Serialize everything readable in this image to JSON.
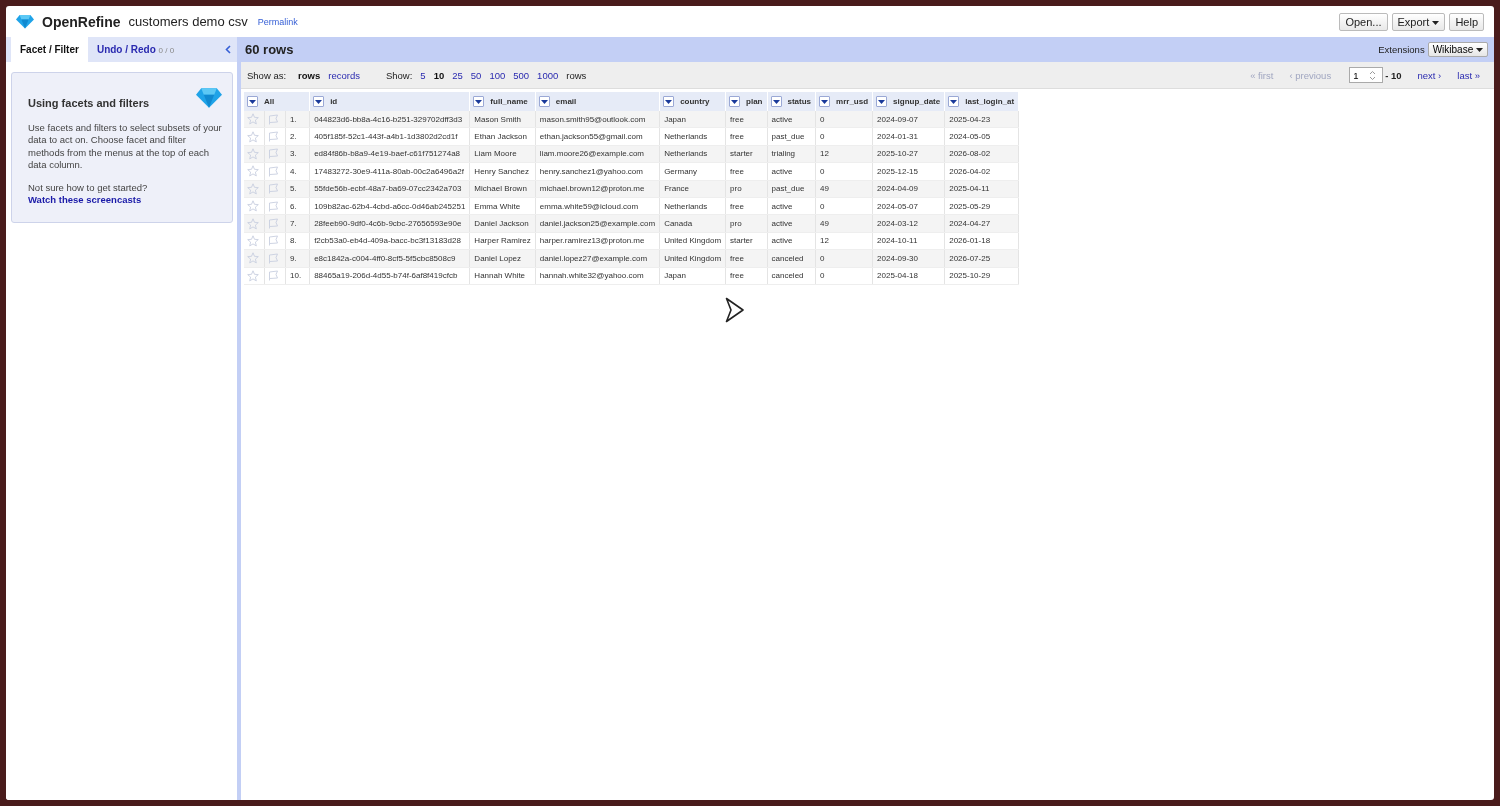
{
  "app": {
    "name": "OpenRefine",
    "project": "customers demo csv",
    "permalink": "Permalink"
  },
  "top_buttons": [
    {
      "label": "Open...",
      "dropdown": false
    },
    {
      "label": "Export",
      "dropdown": true
    },
    {
      "label": "Help",
      "dropdown": false
    }
  ],
  "left_tabs": [
    {
      "label": "Facet / Filter",
      "selected": true
    },
    {
      "label": "Undo / Redo",
      "count": "0 / 0",
      "selected": false
    }
  ],
  "help_card": {
    "title": "Using facets and filters",
    "body": "Use facets and filters to select subsets of your data to act on. Choose facet and filter methods from the menus at the top of each data column.",
    "prompt": "Not sure how to get started?",
    "link": "Watch these screencasts"
  },
  "grid_header": {
    "row_count": "60 rows",
    "extensions_label": "Extensions",
    "extensions_button": "Wikibase"
  },
  "view_bar": {
    "show_as_label": "Show as:",
    "modes": [
      {
        "label": "rows",
        "selected": true
      },
      {
        "label": "records",
        "selected": false
      }
    ],
    "show_label": "Show:",
    "page_sizes": [
      {
        "label": "5",
        "selected": false
      },
      {
        "label": "10",
        "selected": true
      },
      {
        "label": "25",
        "selected": false
      },
      {
        "label": "50",
        "selected": false
      },
      {
        "label": "100",
        "selected": false
      },
      {
        "label": "500",
        "selected": false
      },
      {
        "label": "1000",
        "selected": false
      }
    ],
    "unit": "rows"
  },
  "pager": {
    "first": {
      "label": "« first",
      "disabled": true
    },
    "previous": {
      "label": "‹ previous",
      "disabled": true
    },
    "page": "1",
    "to": "- 10",
    "next": {
      "label": "next ›",
      "disabled": false
    },
    "last": {
      "label": "last »",
      "disabled": false
    }
  },
  "table": {
    "all_label": "All",
    "columns": [
      "id",
      "full_name",
      "email",
      "country",
      "plan",
      "status",
      "mrr_usd",
      "signup_date",
      "last_login_at"
    ],
    "rows": [
      {
        "number": "1.",
        "starred": false,
        "flagged": false,
        "cells": [
          "044823d6-bb8a-4c16-b251-329702dff3d3",
          "Mason Smith",
          "mason.smith95@outlook.com",
          "Japan",
          "free",
          "active",
          "0",
          "2024-09-07",
          "2025-04-23"
        ]
      },
      {
        "number": "2.",
        "starred": false,
        "flagged": false,
        "cells": [
          "405f185f-52c1-443f-a4b1-1d3802d2cd1f",
          "Ethan Jackson",
          "ethan.jackson55@gmail.com",
          "Netherlands",
          "free",
          "past_due",
          "0",
          "2024-01-31",
          "2024-05-05"
        ]
      },
      {
        "number": "3.",
        "starred": false,
        "flagged": false,
        "cells": [
          "ed84f86b-b8a9-4e19-baef-c61f751274a8",
          "Liam Moore",
          "liam.moore26@example.com",
          "Netherlands",
          "starter",
          "trialing",
          "12",
          "2025-10-27",
          "2026-08-02"
        ]
      },
      {
        "number": "4.",
        "starred": false,
        "flagged": false,
        "cells": [
          "17483272-30e9-411a-80ab-00c2a6496a2f",
          "Henry Sanchez",
          "henry.sanchez1@yahoo.com",
          "Germany",
          "free",
          "active",
          "0",
          "2025-12-15",
          "2026-04-02"
        ]
      },
      {
        "number": "5.",
        "starred": false,
        "flagged": false,
        "cells": [
          "55fde56b-ecbf-48a7-ba69-07cc2342a703",
          "Michael Brown",
          "michael.brown12@proton.me",
          "France",
          "pro",
          "past_due",
          "49",
          "2024-04-09",
          "2025-04-11"
        ]
      },
      {
        "number": "6.",
        "starred": false,
        "flagged": false,
        "cells": [
          "109b82ac-62b4-4cbd-a6cc-0d46ab245251",
          "Emma White",
          "emma.white59@icloud.com",
          "Netherlands",
          "free",
          "active",
          "0",
          "2024-05-07",
          "2025-05-29"
        ]
      },
      {
        "number": "7.",
        "starred": false,
        "flagged": false,
        "cells": [
          "28feeb90-9df0-4c6b-9cbc-27656593e90e",
          "Daniel Jackson",
          "daniel.jackson25@example.com",
          "Canada",
          "pro",
          "active",
          "49",
          "2024-03-12",
          "2024-04-27"
        ]
      },
      {
        "number": "8.",
        "starred": false,
        "flagged": false,
        "cells": [
          "f2cb53a0-eb4d-409a-bacc-bc3f13183d28",
          "Harper Ramirez",
          "harper.ramirez13@proton.me",
          "United Kingdom",
          "starter",
          "active",
          "12",
          "2024-10-11",
          "2026-01-18"
        ]
      },
      {
        "number": "9.",
        "starred": false,
        "flagged": false,
        "cells": [
          "e8c1842a-c004-4ff0-8cf5-5f5cbc8508c9",
          "Daniel Lopez",
          "daniel.lopez27@example.com",
          "United Kingdom",
          "free",
          "canceled",
          "0",
          "2024-09-30",
          "2026-07-25"
        ]
      },
      {
        "number": "10.",
        "starred": false,
        "flagged": false,
        "cells": [
          "88465a19-206d-4d55-b74f-6af8f419cfcb",
          "Hannah White",
          "hannah.white32@yahoo.com",
          "Japan",
          "free",
          "canceled",
          "0",
          "2025-04-18",
          "2025-10-29"
        ]
      }
    ]
  }
}
